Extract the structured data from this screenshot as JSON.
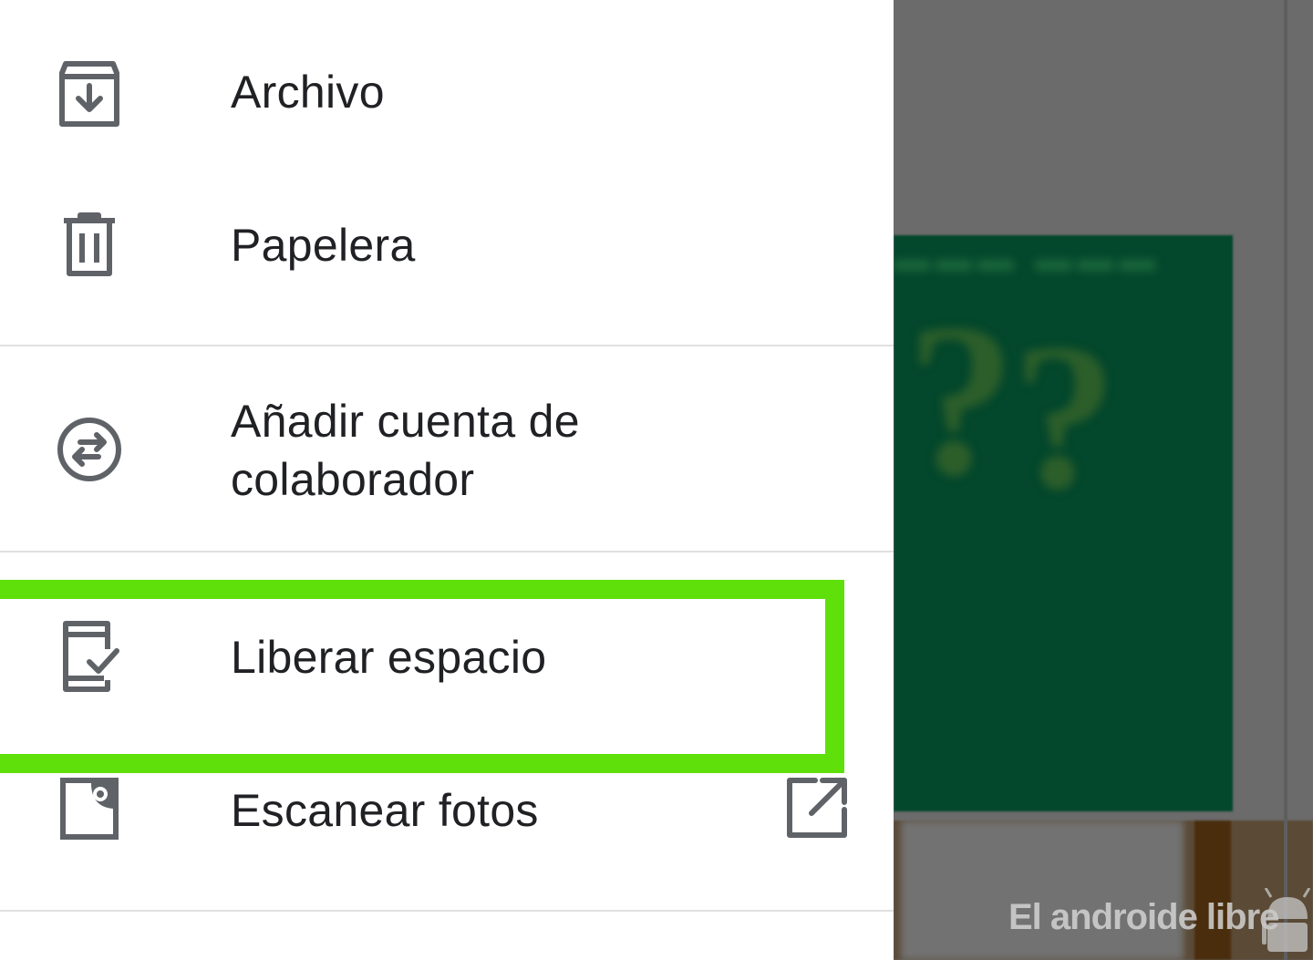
{
  "drawer": {
    "items": [
      {
        "label": "Archivo",
        "icon": "archive-icon"
      },
      {
        "label": "Papelera",
        "icon": "trash-icon"
      },
      {
        "label": "Añadir cuenta de colaborador",
        "icon": "switch-account-icon"
      },
      {
        "label": "Liberar espacio",
        "icon": "free-up-space-icon",
        "highlighted": true
      },
      {
        "label": "Escanear fotos",
        "icon": "photo-scan-icon",
        "trailing_icon": "open-external-icon"
      }
    ]
  },
  "background": {
    "watermark": "El androide libre"
  },
  "colors": {
    "highlight": "#5fe00b",
    "icon": "#5f6368",
    "text": "#202124",
    "scrim": "#6b6b6b",
    "card": "#03472c"
  }
}
